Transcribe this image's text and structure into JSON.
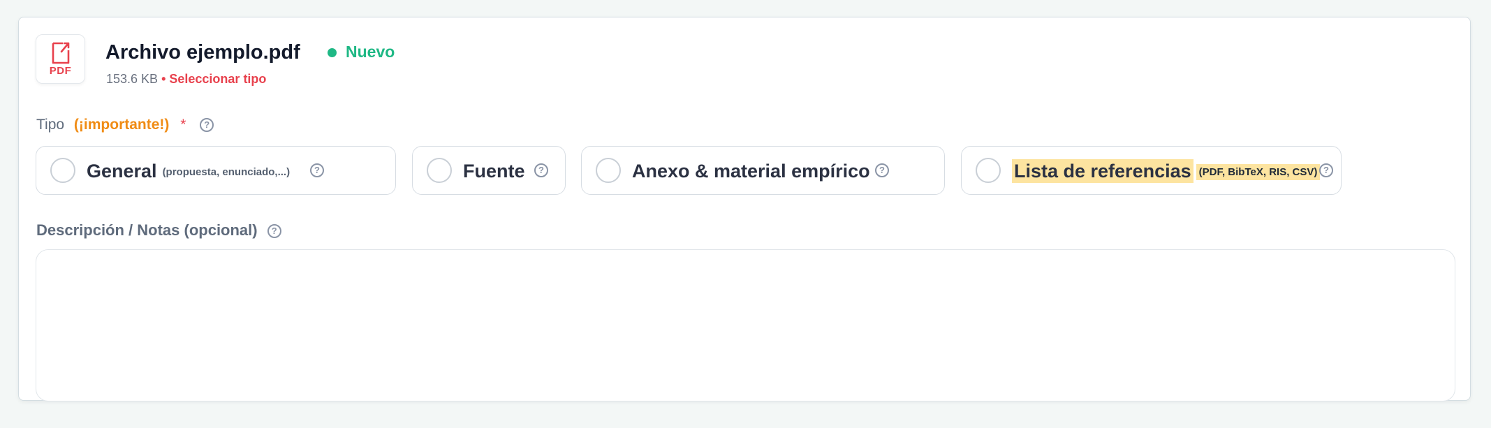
{
  "file": {
    "icon": "pdf-file-icon",
    "icon_label": "PDF",
    "name": "Archivo ejemplo.pdf",
    "status": "Nuevo",
    "status_color": "#1fb885",
    "size": "153.6 KB",
    "meta_warning": "• Seleccionar tipo"
  },
  "tipo": {
    "label": "Tipo",
    "important": "(¡importante!)",
    "required_mark": "*",
    "help": "?",
    "options": [
      {
        "label": "General",
        "sub": "(propuesta, enunciado,...)",
        "help": "?"
      },
      {
        "label": "Fuente",
        "sub": "",
        "help": "?"
      },
      {
        "label": "Anexo & material empírico",
        "sub": "",
        "help": "?"
      },
      {
        "label": "Lista de referencias",
        "sub": "(PDF, BibTeX, RIS, CSV)",
        "help": "?",
        "highlight": "#fde4a0"
      }
    ]
  },
  "description": {
    "label": "Descripción / Notas (opcional)",
    "help": "?",
    "value": ""
  },
  "colors": {
    "accent_red": "#e8414d",
    "important_orange": "#f08c15",
    "success_green": "#1fb885"
  }
}
